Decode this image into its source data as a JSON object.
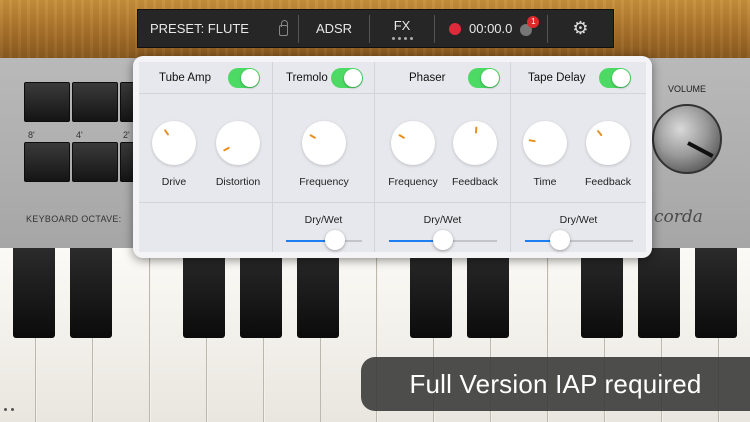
{
  "toolbar": {
    "preset_label": "PRESET: FLUTE",
    "adsr_label": "ADSR",
    "fx_label": "FX",
    "timer": "00:00.0",
    "badge_count": "1"
  },
  "panel": {
    "drawbar_labels": [
      "8'",
      "4'",
      "2'"
    ],
    "keyboard_octave_label": "KEYBOARD OCTAVE:",
    "volume_label": "VOLUME",
    "brand_fragment": "corda"
  },
  "fx": {
    "modules": [
      {
        "name": "Tube Amp",
        "enabled": true,
        "knobs": [
          {
            "label": "Drive",
            "value": 0.35
          },
          {
            "label": "Distortion",
            "value": 0.25
          }
        ]
      },
      {
        "name": "Tremolo",
        "enabled": true,
        "knobs": [
          {
            "label": "Frequency",
            "value": 0.28
          }
        ],
        "dry_wet_label": "Dry/Wet",
        "dry_wet": 0.64
      },
      {
        "name": "Phaser",
        "enabled": true,
        "knobs": [
          {
            "label": "Frequency",
            "value": 0.28
          },
          {
            "label": "Feedback",
            "value": 0.52
          }
        ],
        "dry_wet_label": "Dry/Wet",
        "dry_wet": 0.5
      },
      {
        "name": "Tape Delay",
        "enabled": true,
        "knobs": [
          {
            "label": "Time",
            "value": 0.22
          },
          {
            "label": "Feedback",
            "value": 0.38
          }
        ],
        "dry_wet_label": "Dry/Wet",
        "dry_wet": 0.32
      }
    ]
  },
  "banner": {
    "text": "Full Version IAP required"
  },
  "colors": {
    "accent_blue": "#1c7ef0",
    "toggle_green": "#4cd964",
    "record_red": "#e0293a",
    "knob_indicator": "#e8901d"
  }
}
